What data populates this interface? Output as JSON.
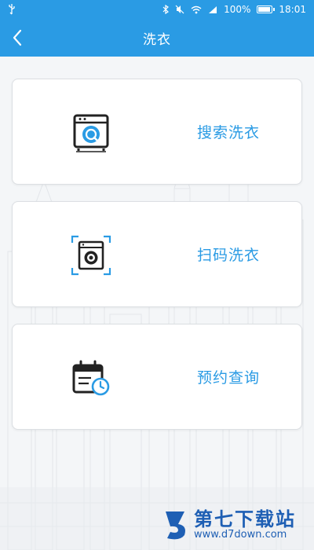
{
  "status_bar": {
    "battery": "100%",
    "time": "18:01",
    "battery_level": 1.0
  },
  "nav": {
    "title": "洗衣"
  },
  "cards": [
    {
      "label": "搜索洗衣",
      "icon": "washer-search-icon"
    },
    {
      "label": "扫码洗衣",
      "icon": "washer-scan-icon"
    },
    {
      "label": "预约查询",
      "icon": "calendar-clock-icon"
    }
  ],
  "watermark": {
    "main": "第七下载站",
    "sub": "www.d7down.com"
  },
  "colors": {
    "primary": "#2a9be4",
    "card_bg": "#ffffff",
    "page_bg": "#f4f6f8",
    "watermark": "#1e5fb4"
  }
}
